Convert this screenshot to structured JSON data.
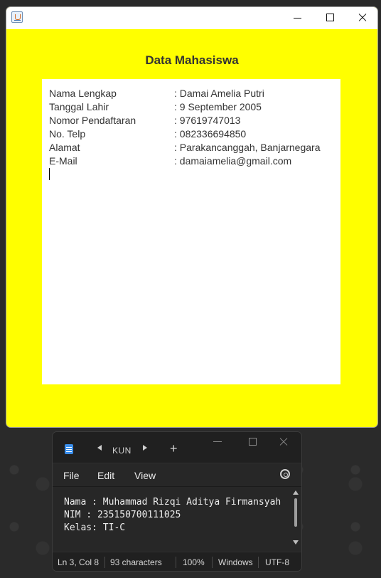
{
  "java_window": {
    "title": "Data Mahasiswa",
    "rows": [
      {
        "label": "Nama Lengkap",
        "value": ": Damai Amelia Putri"
      },
      {
        "label": "Tanggal Lahir",
        "value": ": 9 September 2005"
      },
      {
        "label": "Nomor Pendaftaran",
        "value": ": 97619747013"
      },
      {
        "label": "No. Telp",
        "value": ": 082336694850"
      },
      {
        "label": "Alamat",
        "value": ": Parakancanggah, Banjarnegara"
      },
      {
        "label": "E-Mail",
        "value": ": damaiamelia@gmail.com"
      }
    ],
    "background_color": "#ffff00"
  },
  "notepad": {
    "tab_label": "KUN",
    "menu": [
      "File",
      "Edit",
      "View"
    ],
    "lines": [
      "Nama : Muhammad Rizqi Aditya Firmansyah",
      "NIM : 235150700111025",
      "Kelas: TI-C"
    ],
    "status": {
      "position": "Ln 3, Col 8",
      "characters": "93 characters",
      "zoom": "100%",
      "line_ending": "Windows",
      "encoding": "UTF-8"
    }
  }
}
